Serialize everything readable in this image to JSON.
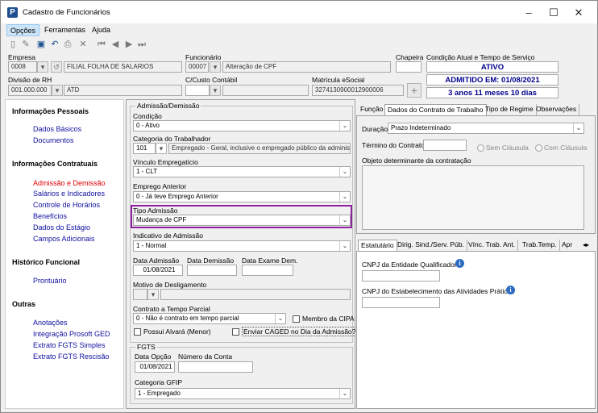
{
  "window": {
    "title": "Cadastro de Funcionários"
  },
  "menu": {
    "items": [
      "Opções",
      "Ferramentas",
      "Ajuda"
    ]
  },
  "header": {
    "empresa_label": "Empresa",
    "empresa_code": "0008",
    "empresa_name": "FILIAL FOLHA DE SALARIOS",
    "funcionario_label": "Funcionário",
    "funcionario_code": "00007",
    "funcionario_name": "Alteração de CPF",
    "chapeira_label": "Chapeira",
    "chapeira_value": "",
    "divisao_label": "Divisão de RH",
    "divisao_code": "001.000.000",
    "divisao_name": "ATD",
    "ccusto_label": "C/Custo Contábil",
    "ccusto_code": "",
    "ccusto_name": "",
    "matricula_label": "Matrícula eSocial",
    "matricula_value": "3274130900012900006",
    "condicao_label": "Condição Atual e Tempo de Serviço",
    "status": "ATIVO",
    "admitido": "ADMITIDO EM: 01/08/2021",
    "tempo": "3 anos 11 meses 10 dias"
  },
  "nav": {
    "sections": [
      {
        "title": "Informações Pessoais",
        "items": [
          "Dados Básicos",
          "Documentos"
        ]
      },
      {
        "title": "Informações Contratuais",
        "items": [
          "Admissão e Demissão",
          "Salários e Indicadores",
          "Controle de Horários",
          "Benefícios",
          "Dados do Estágio",
          "Campos Adicionais"
        ]
      },
      {
        "title": "Histórico Funcional",
        "items": [
          "Prontuário"
        ]
      },
      {
        "title": "Outras",
        "items": [
          "Anotações",
          "Integração Prosoft GED",
          "Extrato FGTS Simples",
          "Extrato FGTS Rescisão"
        ]
      }
    ]
  },
  "admissao": {
    "group_title": "Admissão/Demissão",
    "condicao_label": "Condição",
    "condicao_value": "0 - Ativo",
    "categoria_label": "Categoria do Trabalhador",
    "categoria_code": "101",
    "categoria_value": "Empregado - Geral, inclusive o empregado público da administ",
    "vinculo_label": "Vínculo Empregatício",
    "vinculo_value": "1 - CLT",
    "emprego_label": "Emprego Anterior",
    "emprego_value": "0 - Já teve Emprego Anterior",
    "tipo_label": "Tipo Admissão",
    "tipo_value": "Mudança de CPF",
    "indicativo_label": "Indicativo de Admissão",
    "indicativo_value": "1 - Normal",
    "data_adm_label": "Data Admissão",
    "data_adm_value": "01/08/2021",
    "data_dem_label": "Data Demissão",
    "data_dem_value": "",
    "data_exame_label": "Data Exame Dem.",
    "data_exame_value": "",
    "motivo_label": "Motivo de Desligamento",
    "parcial_label": "Contrato a Tempo Parcial",
    "parcial_value": "0 - Não é contrato em tempo parcial",
    "cipa_label": "Membro da CIPA",
    "alvara_label": "Possui Alvará (Menor)",
    "caged_label": "Enviar CAGED no Dia da Admissão?"
  },
  "fgts": {
    "group_title": "FGTS",
    "data_opcao_label": "Data Opção",
    "data_opcao_value": "01/08/2021",
    "numero_conta_label": "Número da Conta",
    "numero_conta_value": "",
    "categoria_gfip_label": "Categoria GFIP",
    "categoria_gfip_value": "1 - Empregado"
  },
  "contrato": {
    "tabs": [
      "Função",
      "Dados do Contrato de Trabalho",
      "Tipo de Regime",
      "Observações"
    ],
    "duracao_label": "Duração",
    "duracao_value": "Prazo Indeterminado",
    "termino_label": "Término do Contrato",
    "termino_value": "",
    "sem_clausula_label": "Sem Cláusula",
    "com_clausula_label": "Com Cláusula",
    "objeto_label": "Objeto determinante da contratação"
  },
  "estatutario": {
    "tabs": [
      "Estatutário",
      "Dirig. Sind./Serv. Púb.",
      "Vínc. Trab. Ant.",
      "Trab.Temp.",
      "Apr"
    ],
    "cnpj_qualif_label": "CNPJ da Entidade Qualificadora",
    "cnpj_pratica_label": "CNPJ do Estabelecimento das Atividades Práticas"
  },
  "colors": {
    "accent": "#00008b",
    "nav_link": "#1010a0",
    "nav_active": "#e00000",
    "highlight": "#8e1f9e"
  }
}
